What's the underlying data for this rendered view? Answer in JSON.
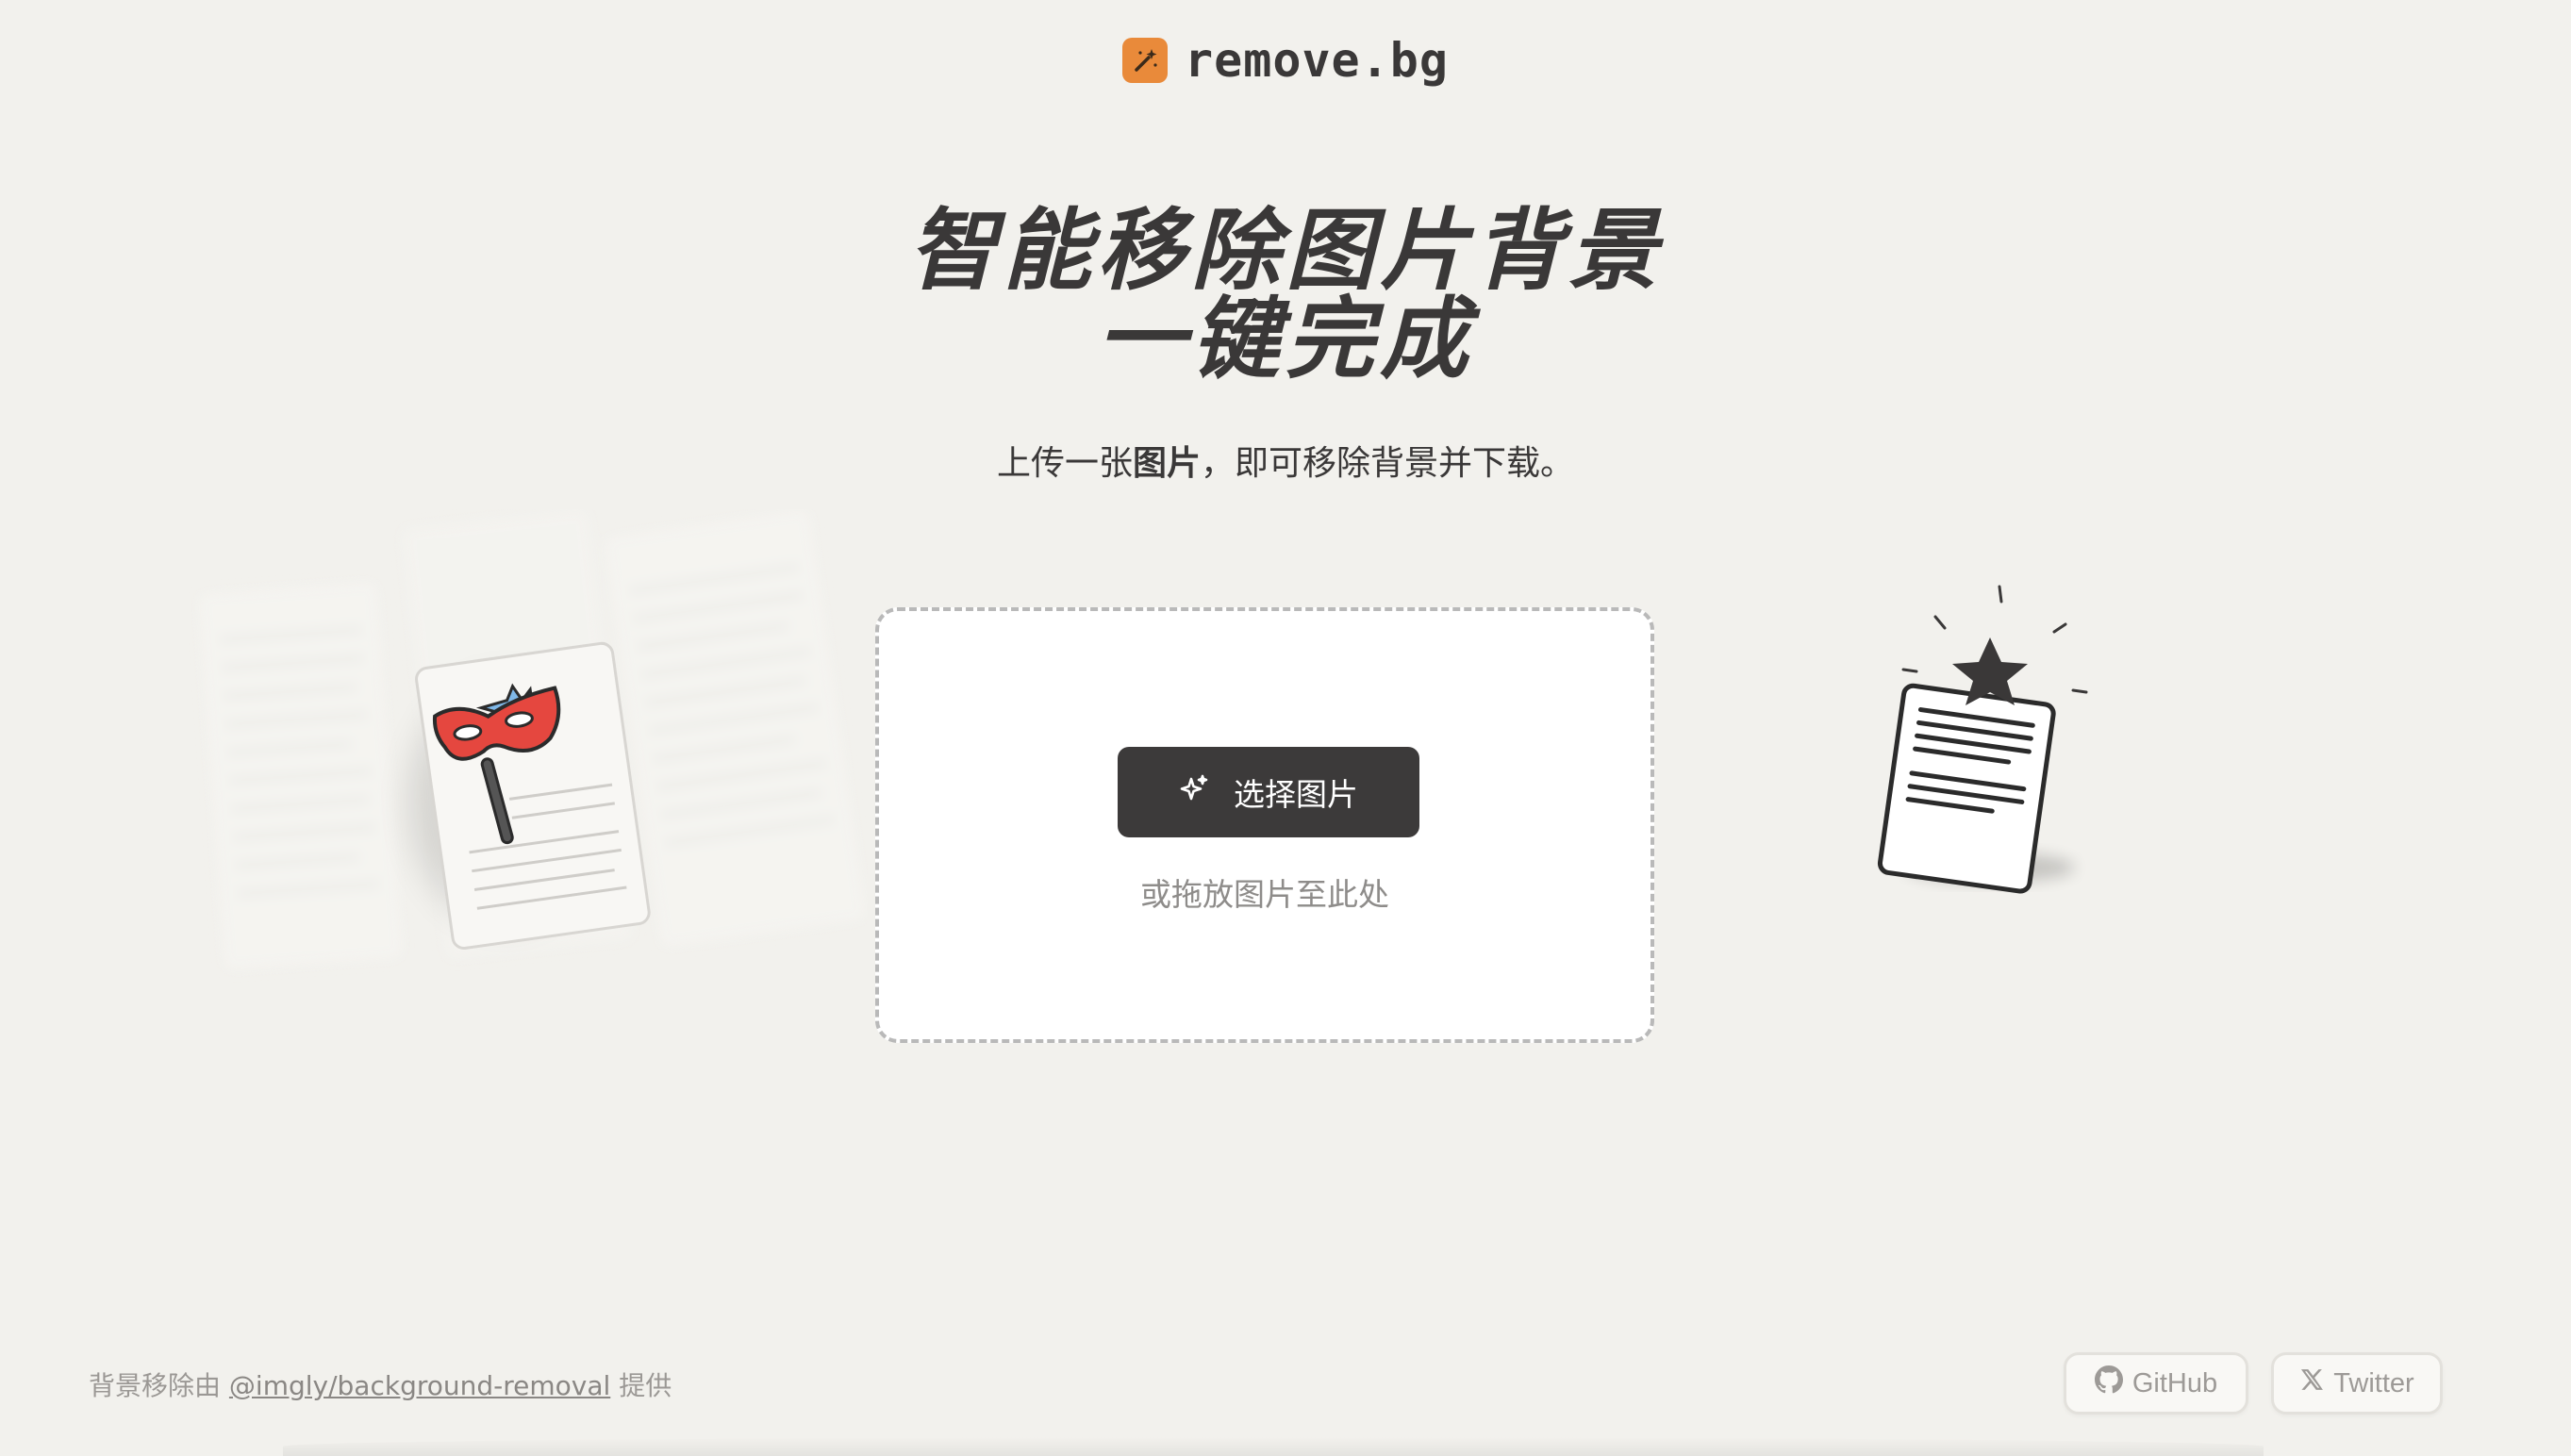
{
  "header": {
    "brand": "remove.bg",
    "logo_icon": "magic-wand-icon"
  },
  "hero": {
    "line1": "智能移除图片背景",
    "line2": "一键完成"
  },
  "subtitle": {
    "pre": "上传一张",
    "bold": "图片",
    "post": "，即可移除背景并下载。"
  },
  "upload": {
    "button_label": "选择图片",
    "button_icon": "sparkle-icon",
    "drop_hint": "或拖放图片至此处"
  },
  "footer": {
    "credit_pre": "背景移除由",
    "credit_link": "@imgly/background-removal",
    "credit_post": "提供",
    "github_label": "GitHub",
    "twitter_label": "Twitter"
  },
  "colors": {
    "accent": "#e98a3a",
    "button": "#3c3a3a",
    "background": "#f2f1ed",
    "mask": "#e5473f"
  }
}
